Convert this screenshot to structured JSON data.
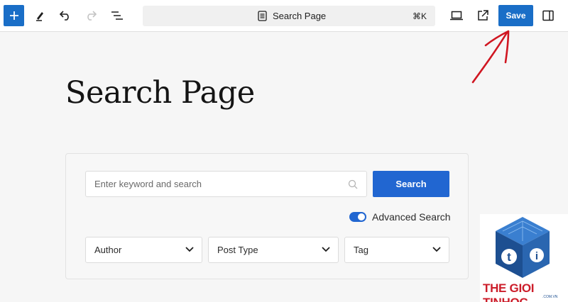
{
  "toolbar": {
    "command_bar_title": "Search Page",
    "command_shortcut": "⌘K",
    "save_label": "Save"
  },
  "page": {
    "title": "Search Page"
  },
  "search_form": {
    "input_placeholder": "Enter keyword and search",
    "button_label": "Search",
    "advanced_search_label": "Advanced Search",
    "advanced_search_enabled": true,
    "filters": [
      {
        "label": "Author"
      },
      {
        "label": "Post Type"
      },
      {
        "label": "Tag"
      }
    ]
  },
  "watermark": {
    "text": "THE GIOI TINHOC",
    "sub": ".COM.VN",
    "logo_letters": "ti"
  },
  "colors": {
    "accent": "#1a6ec7",
    "search_button": "#2166d1",
    "annotation_arrow": "#d01621",
    "watermark_red": "#cc1d2a",
    "watermark_blue": "#1d4f91"
  }
}
